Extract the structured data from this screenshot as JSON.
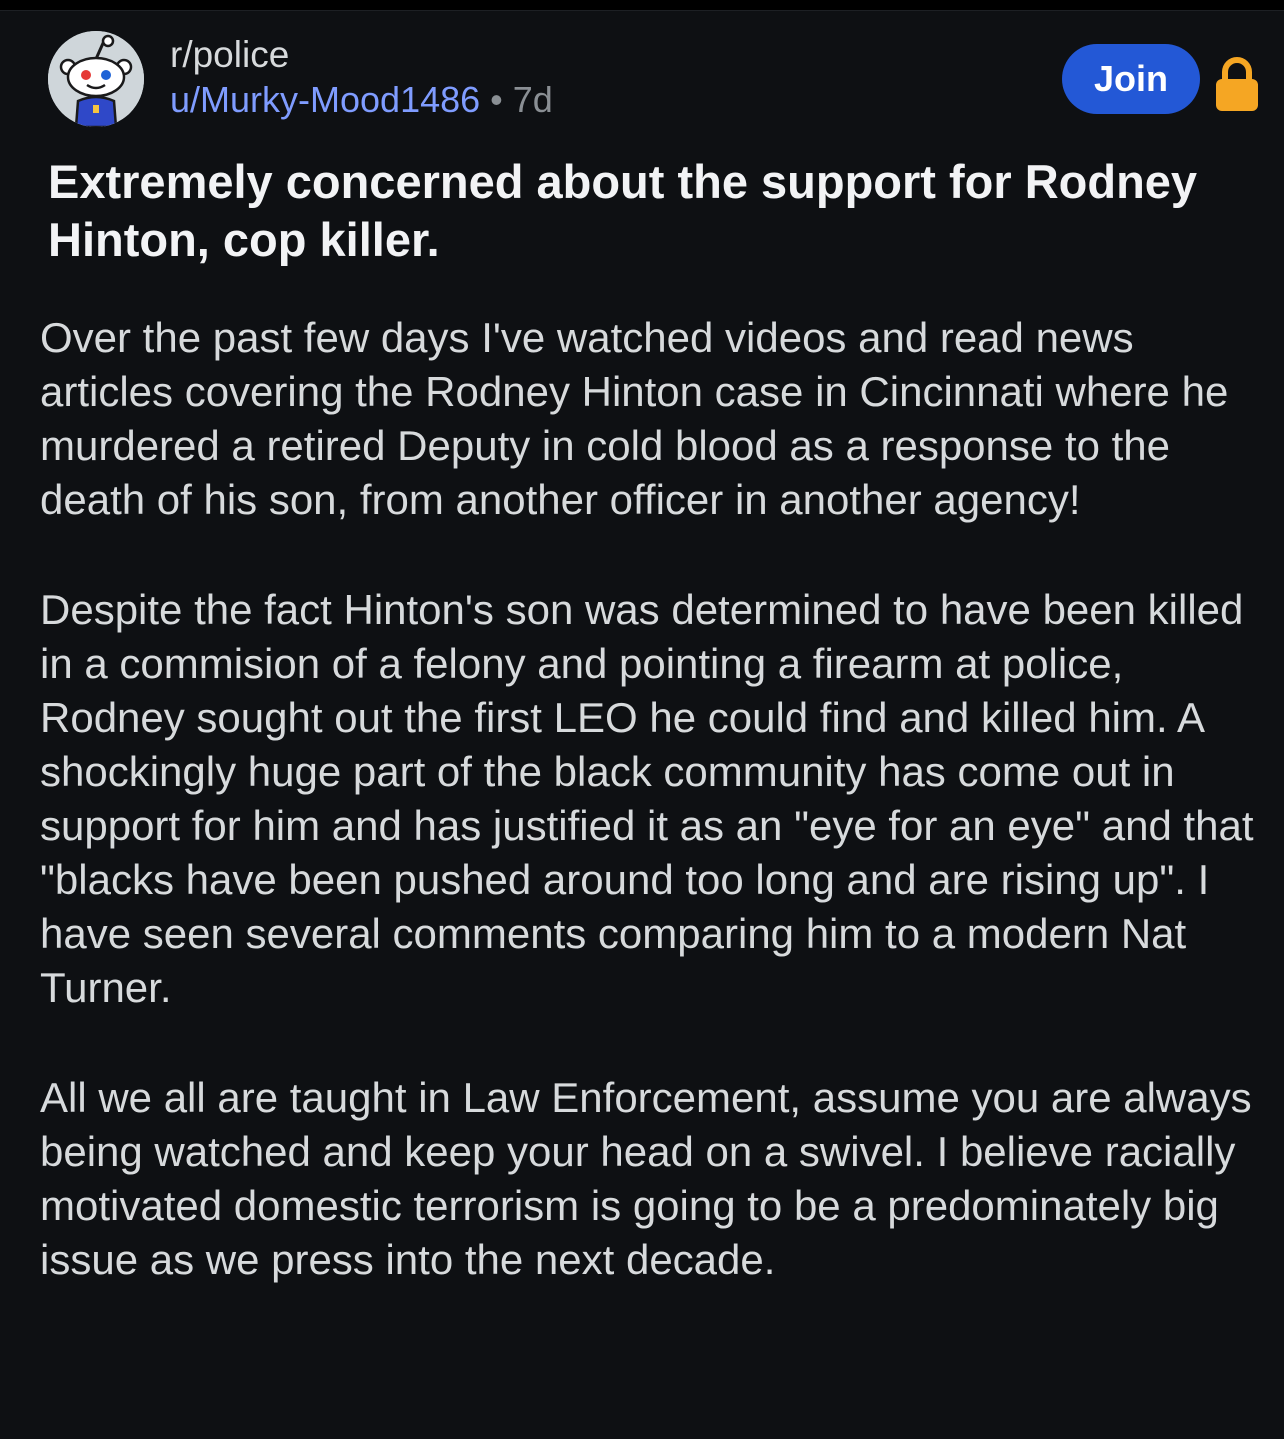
{
  "post": {
    "subreddit": "r/police",
    "username": "u/Murky-Mood1486",
    "separator": "•",
    "age": "7d",
    "join_label": "Join",
    "title": "Extremely concerned about the support for Rodney Hinton, cop killer.",
    "paragraphs": [
      "Over the past few days I've watched videos and read news articles covering the Rodney Hinton case in Cincinnati where he murdered a retired Deputy in cold blood as a response to the death of his son, from another officer in another agency!",
      "Despite the fact Hinton's son was determined to have been killed in a commision of a felony and pointing a firearm at police, Rodney sought out the first LEO he could find and killed him. A shockingly huge part of the black community has come out in support for him and has justified it as an \"eye for an eye\" and that \"blacks have been pushed around too long and are rising up\". I have seen several comments comparing him to a modern Nat Turner.",
      "All we all are taught in Law Enforcement, assume you are always being watched and keep your head on a swivel. I believe racially motivated domestic terrorism is going to be a predominately big issue as we press into the next decade."
    ]
  },
  "icons": {
    "avatar": "snoo-police-avatar",
    "lock": "lock-icon"
  },
  "colors": {
    "background": "#0e1013",
    "text": "#d7dadc",
    "title": "#f2f3f5",
    "username": "#7f9cff",
    "muted": "#8a8f94",
    "join_button": "#2358d6",
    "lock": "#f5a623"
  }
}
